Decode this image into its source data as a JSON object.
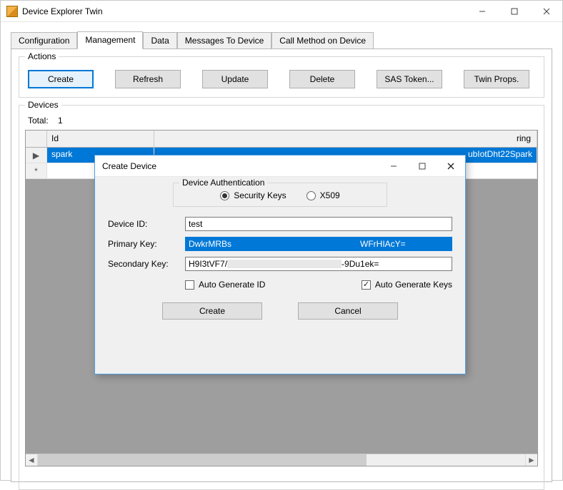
{
  "window": {
    "title": "Device Explorer Twin"
  },
  "tabs": {
    "items": [
      "Configuration",
      "Management",
      "Data",
      "Messages To Device",
      "Call Method on Device"
    ],
    "active": 1
  },
  "actions": {
    "legend": "Actions",
    "buttons": {
      "create": "Create",
      "refresh": "Refresh",
      "update": "Update",
      "delete": "Delete",
      "sas": "SAS Token...",
      "twin": "Twin Props."
    }
  },
  "devices": {
    "legend": "Devices",
    "total_label": "Total:",
    "total_value": "1",
    "columns": {
      "id": "Id",
      "conn_partial": "ring"
    },
    "rows": [
      {
        "selector": "▶",
        "id": "spark",
        "conn_partial": "ubIotDht22Spark"
      },
      {
        "selector": "*",
        "id": "",
        "conn_partial": ""
      }
    ]
  },
  "dialog": {
    "title": "Create Device",
    "auth": {
      "legend": "Device Authentication",
      "security_keys": "Security Keys",
      "x509": "X509",
      "selected": "security_keys"
    },
    "fields": {
      "device_id_label": "Device ID:",
      "device_id_value": "test",
      "primary_label": "Primary Key:",
      "primary_left": "DwkrMRBs",
      "primary_right": "WFrHIAcY=",
      "secondary_label": "Secondary Key:",
      "secondary_left": "H9I3tVF7/",
      "secondary_right": "-9Du1ek="
    },
    "checks": {
      "auto_id": "Auto Generate ID",
      "auto_keys": "Auto Generate Keys",
      "auto_id_checked": false,
      "auto_keys_checked": true
    },
    "buttons": {
      "create": "Create",
      "cancel": "Cancel"
    }
  }
}
